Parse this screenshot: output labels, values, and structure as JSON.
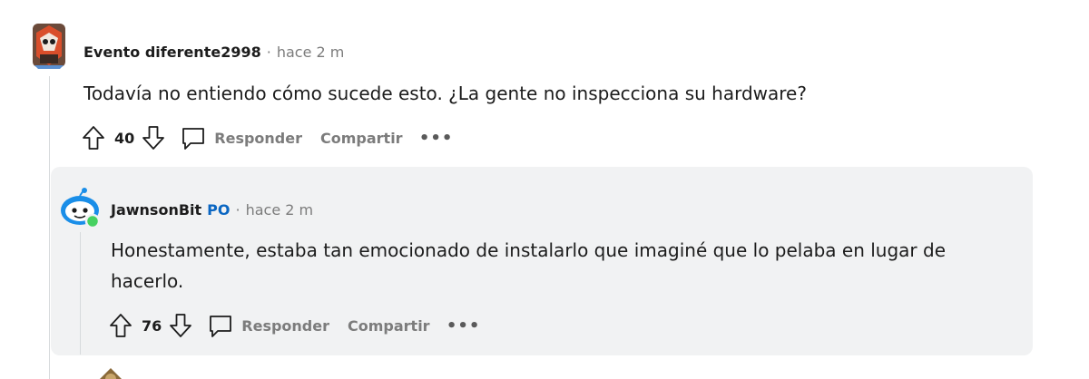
{
  "comment1": {
    "username": "Evento diferente2998",
    "separator": "·",
    "time": "hace 2 m",
    "body": "Todavía no entiendo cómo sucede esto. ¿La gente no inspecciona su hardware?",
    "votes": "40",
    "reply_label": "Responder",
    "share_label": "Compartir",
    "more_label": "•••"
  },
  "comment2": {
    "username": "JawnsonBit",
    "op_badge": "PO",
    "separator": "·",
    "time": "hace 2 m",
    "body": "Honestamente, estaba tan emocionado de instalarlo que imaginé que lo pelaba en lugar de hacerlo.",
    "votes": "76",
    "reply_label": "Responder",
    "share_label": "Compartir",
    "more_label": "•••"
  },
  "comment3": {
    "username": "",
    "time": ""
  },
  "colors": {
    "reply_card_bg": "#f1f2f3",
    "meta_text": "#7c7c7c",
    "op_badge": "#0a66c2",
    "online_dot": "#46d160"
  },
  "icons": {
    "upvote": "upvote-arrow-icon",
    "downvote": "downvote-arrow-icon",
    "reply": "comment-bubble-icon",
    "more": "more-options-icon"
  }
}
